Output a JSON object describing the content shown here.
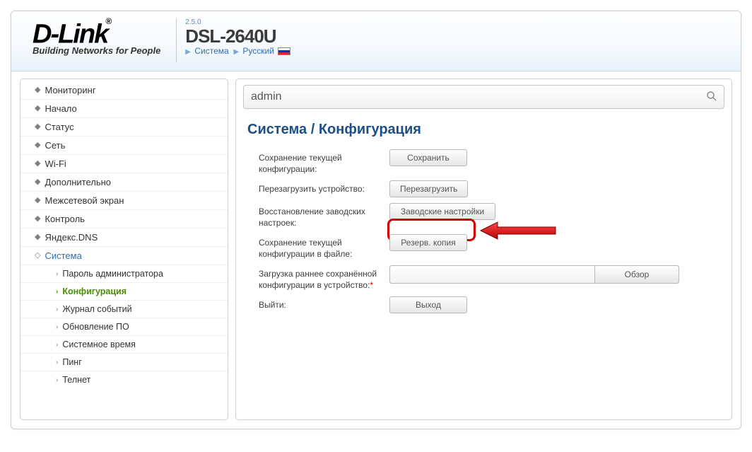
{
  "header": {
    "logo_text": "D-Link",
    "logo_reg": "®",
    "tagline": "Building Networks for People",
    "version": "2.5.0",
    "model": "DSL-2640U",
    "breadcrumb_system": "Система",
    "breadcrumb_lang": "Русский"
  },
  "search": {
    "value": "admin"
  },
  "nav": {
    "items": [
      {
        "label": "Мониторинг"
      },
      {
        "label": "Начало"
      },
      {
        "label": "Статус"
      },
      {
        "label": "Сеть"
      },
      {
        "label": "Wi-Fi"
      },
      {
        "label": "Дополнительно"
      },
      {
        "label": "Межсетевой экран"
      },
      {
        "label": "Контроль"
      },
      {
        "label": "Яндекс.DNS"
      },
      {
        "label": "Система"
      }
    ],
    "sub": [
      {
        "label": "Пароль администратора"
      },
      {
        "label": "Конфигурация"
      },
      {
        "label": "Журнал событий"
      },
      {
        "label": "Обновление ПО"
      },
      {
        "label": "Системное время"
      },
      {
        "label": "Пинг"
      },
      {
        "label": "Телнет"
      }
    ]
  },
  "main": {
    "title": "Система /  Конфигурация",
    "rows": {
      "save_label": "Сохранение текущей конфигурации:",
      "save_btn": "Сохранить",
      "reboot_label": "Перезагрузить устройство:",
      "reboot_btn": "Перезагрузить",
      "factory_label": "Восстановление заводских настроек:",
      "factory_btn": "Заводские настройки",
      "backup_label": "Сохранение текущей конфигурации в файле:",
      "backup_btn": "Резерв. копия",
      "upload_label": "Загрузка раннее сохранённой конфигурации в устройство:",
      "upload_req": "*",
      "browse_btn": "Обзор",
      "logout_label": "Выйти:",
      "logout_btn": "Выход"
    }
  }
}
